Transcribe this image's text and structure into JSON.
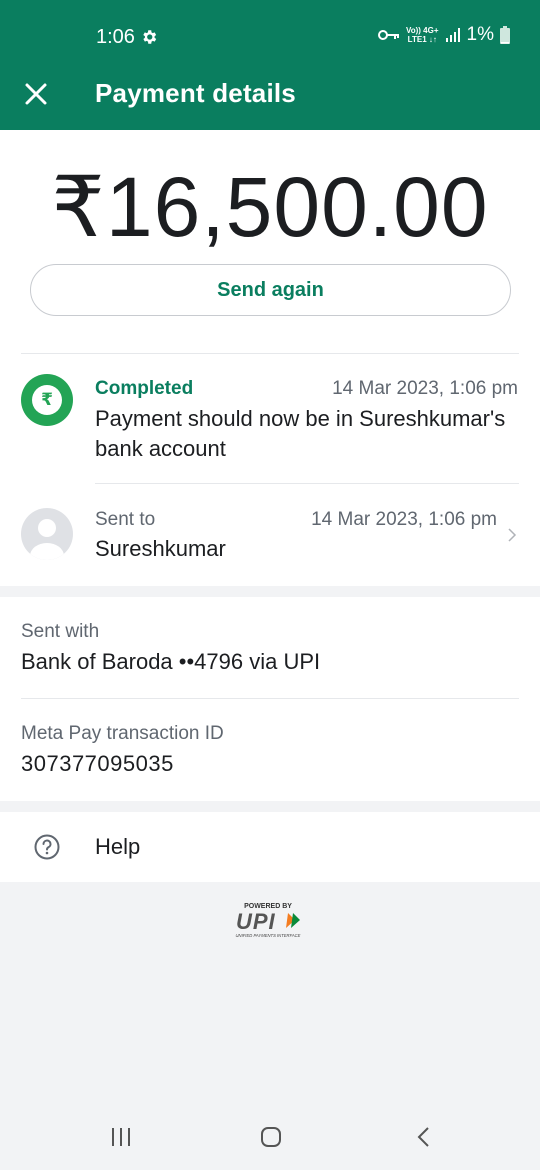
{
  "status_bar": {
    "time": "1:06",
    "network_top": "Vo)) 4G+",
    "network_bottom": "LTE1 ↓↑",
    "battery": "1%"
  },
  "header": {
    "title": "Payment details",
    "close_icon": "close-icon",
    "background_color": "#0a7e5f"
  },
  "payment": {
    "amount": "₹16,500.00",
    "send_again_label": "Send again"
  },
  "status": {
    "label": "Completed",
    "timestamp": "14 Mar 2023, 1:06 pm",
    "message": "Payment should now be in Sureshkumar's bank account",
    "icon_symbol": "₹",
    "accent_color": "#23a455"
  },
  "recipient": {
    "label": "Sent to",
    "timestamp": "14 Mar 2023, 1:06 pm",
    "name": "Sureshkumar"
  },
  "details": {
    "sent_with_label": "Sent with",
    "sent_with_value": "Bank of Baroda ••4796 via UPI",
    "transaction_label": "Meta Pay transaction ID",
    "transaction_id": "307377095035"
  },
  "help": {
    "label": "Help"
  },
  "footer": {
    "powered_by": "POWERED BY",
    "upi": "UPI",
    "upi_tagline": "UNIFIED PAYMENTS INTERFACE"
  },
  "nav_bar": {
    "icons": [
      "recent-apps-icon",
      "home-icon",
      "back-icon"
    ]
  }
}
